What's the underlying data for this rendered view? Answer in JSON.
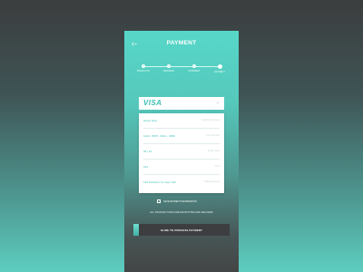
{
  "header": {
    "back_icon": "‹-",
    "title": "PAYMENT"
  },
  "steps": [
    {
      "label": "PRODUCTS"
    },
    {
      "label": "ADDRESS"
    },
    {
      "label": "SHIPMENT"
    },
    {
      "label": "PAYMENT"
    }
  ],
  "card_type": {
    "selected": "VISA",
    "chevron": "⌄"
  },
  "form": [
    {
      "value": "Name Here",
      "hint": "Cardholder Name"
    },
    {
      "value": "1234 - 5678 - 9012 - 3456",
      "hint": "Card Number"
    },
    {
      "value": "06 / 24",
      "hint": "Expiry Date"
    },
    {
      "value": "012",
      "hint": "CVV"
    },
    {
      "value": "123 Southern St. New York",
      "hint": "Billing Address"
    }
  ],
  "save_label": "SAVE PAYMENT INFORMATION",
  "secure_note": "ALL TRANSACTIONS ARE ENCRYPTED AND SECURED",
  "slide_label": "SLIDE TO PROCESS PAYMENT",
  "colors": {
    "accent": "#3cc1b3",
    "slider_bg": "#3c3e40"
  }
}
